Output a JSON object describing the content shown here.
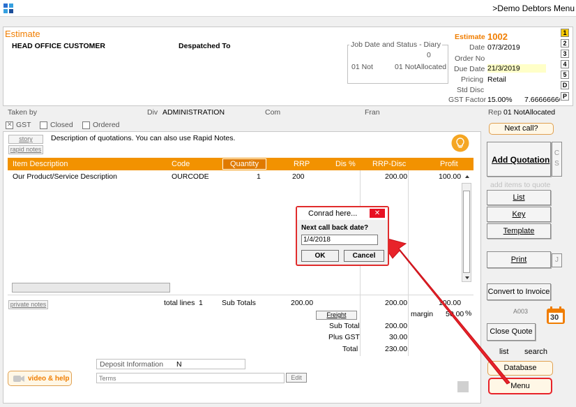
{
  "window": {
    "title": ">Demo Debtors Menu",
    "app_icon": "app-grid-icon"
  },
  "header": {
    "doc_type": "Estimate",
    "customer": "HEAD OFFICE CUSTOMER",
    "despatched_to": "Despatched To",
    "diary": {
      "title": "Job Date and Status - Diary",
      "count": "0",
      "status_left": "01 Not",
      "status_right": "01 NotAllocated"
    },
    "fields": {
      "estimate_label": "Estimate",
      "estimate_value": "1002",
      "date_label": "Date",
      "date_value": "07/3/2019",
      "order_no_label": "Order No",
      "order_no_value": "",
      "due_date_label": "Due Date",
      "due_date_value": "21/3/2019",
      "pricing_label": "Pricing",
      "pricing_value": "Retail",
      "std_disc_label": "Std Disc",
      "std_disc_value": "",
      "gst_factor_label": "GST Factor",
      "gst_factor_value": "15.00%",
      "gst_factor_extra": "7.66666666"
    },
    "page_tabs": [
      "1",
      "2",
      "3",
      "4",
      "5",
      "D",
      "P"
    ]
  },
  "info_bar": {
    "taken_by_label": "Taken by",
    "div_label": "Div",
    "div_value": "ADMINISTRATION",
    "com_label": "Com",
    "fran_label": "Fran",
    "rep_label": "Rep",
    "rep_value": "01 NotAllocated"
  },
  "options": {
    "gst_label": "GST",
    "gst_checked": true,
    "closed_label": "Closed",
    "closed_checked": false,
    "ordered_label": "Ordered",
    "ordered_checked": false
  },
  "story": {
    "story_button": "story",
    "rapid_notes_button": "rapid notes",
    "description": "Description of quotations. You can also use Rapid Notes.",
    "bulb_icon": "lightbulb-icon"
  },
  "grid": {
    "columns": [
      "Item Description",
      "Code",
      "Quantity",
      "RRP",
      "Dis %",
      "RRP-Disc",
      "Profit"
    ],
    "rows": [
      {
        "description": "Our Product/Service Description",
        "code": "OURCODE",
        "quantity": "1",
        "rrp": "200",
        "dis": "",
        "rrp_disc": "200.00",
        "profit": "100.00"
      }
    ]
  },
  "totals": {
    "private_notes_button": "private notes",
    "total_lines_label": "total lines",
    "total_lines_value": "1",
    "sub_totals_label": "Sub Totals",
    "sub_totals_rrp": "200.00",
    "sub_totals_rrp_disc": "200.00",
    "sub_totals_profit": "100.00",
    "freight_button": "Freight",
    "margin_label": "margin",
    "margin_value": "50.00",
    "margin_unit": "%",
    "sub_total_label": "Sub Total",
    "sub_total_value": "200.00",
    "plus_gst_label": "Plus GST",
    "plus_gst_value": "30.00",
    "total_label": "Total",
    "total_value": "230.00"
  },
  "bottom": {
    "video_help": "video & help",
    "deposit_label": "Deposit Information",
    "deposit_value": "N",
    "terms_placeholder": "Terms",
    "edit_button": "Edit"
  },
  "right_panel": {
    "next_call": "Next call?",
    "add_quotation": "Add Quotation",
    "cs": "C S",
    "add_items_hint": "add items to quote",
    "list": "List",
    "key": "Key",
    "template": "Template",
    "print": "Print",
    "print_side": "J",
    "convert_to_invoice": "Convert to Invoice",
    "code": "A003",
    "calendar_day": "30",
    "close_quote": "Close Quote",
    "list_link": "list",
    "search_link": "search",
    "database": "Database",
    "menu": "Menu"
  },
  "dialog": {
    "title": "Conrad here...",
    "prompt": "Next call back date?",
    "input_value": "1/4/2018",
    "ok": "OK",
    "cancel": "Cancel"
  },
  "colors": {
    "accent_orange": "#f07d00",
    "header_orange": "#f29200",
    "highlight_red": "#e8232a"
  }
}
